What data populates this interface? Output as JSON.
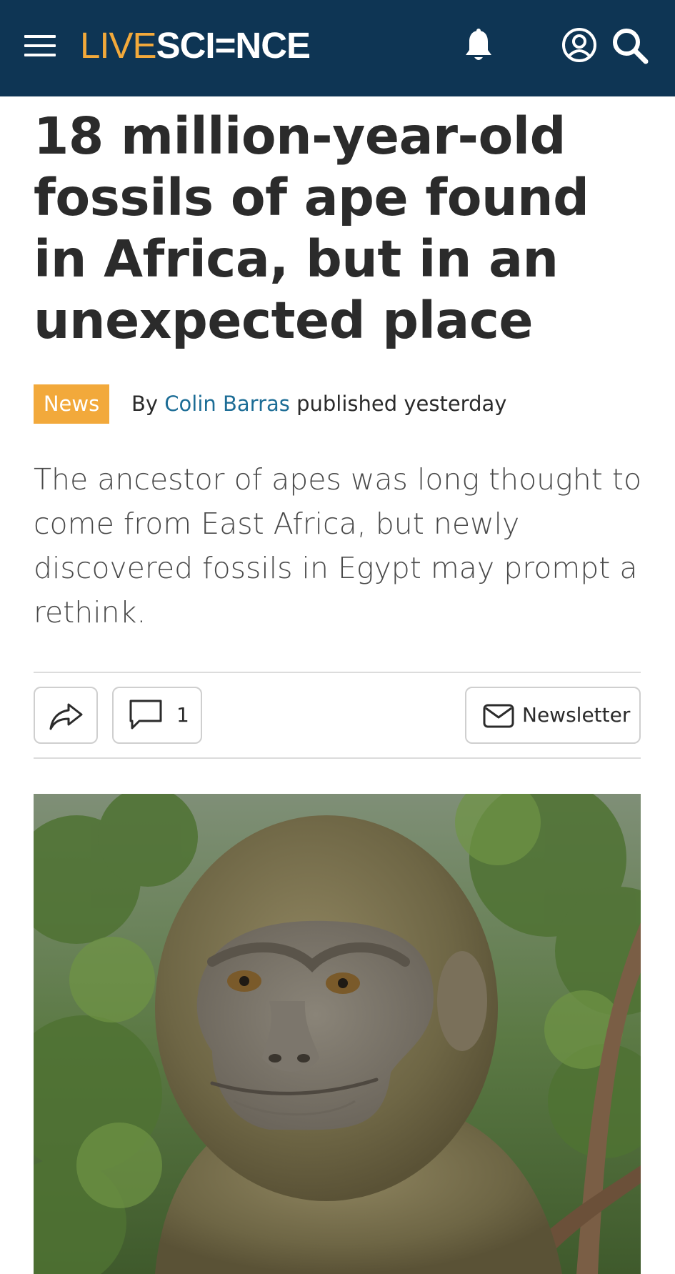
{
  "header": {
    "logo_live": "LIVE",
    "logo_science": "SCI=NCE",
    "icons": [
      "menu-icon",
      "bell-icon",
      "account-icon",
      "search-icon"
    ],
    "background_color": "#0e3554",
    "logo_accent_color": "#f2a93b"
  },
  "article": {
    "headline": "18 million-year-old fossils of ape found in Africa, but in an unexpected place",
    "category_badge": "News",
    "byline_prefix": "By",
    "author": "Colin Barras",
    "published": "published yesterday",
    "standfirst": "The ancestor of apes was long thought to come from East Africa, but newly discovered fossils in Egypt may prompt a rethink.",
    "accent_badge_color": "#f2a93b",
    "author_link_color": "#1d6d96"
  },
  "share_bar": {
    "share_icon": "share-arrow-icon",
    "comment_icon": "comment-icon",
    "comment_count": "1",
    "newsletter_icon": "envelope-icon",
    "newsletter_label": "Newsletter"
  },
  "hero_image": {
    "subject": "illustration of an ape face in a green forest"
  }
}
